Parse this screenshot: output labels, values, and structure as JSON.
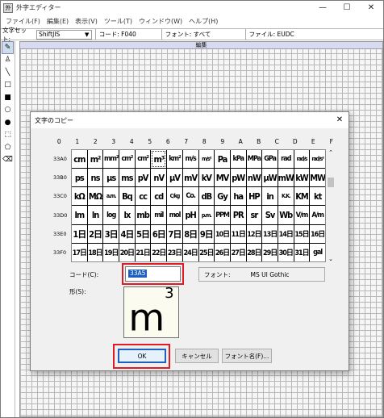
{
  "window": {
    "title": "外字エディター",
    "icon": "外",
    "min": "—",
    "max": "☐",
    "close": "✕"
  },
  "menu": [
    "ファイル(F)",
    "編集(E)",
    "表示(V)",
    "ツール(T)",
    "ウィンドウ(W)",
    "ヘルプ(H)"
  ],
  "infobar": {
    "charset_label": "文字セット:",
    "charset_value": "ShiftJIS",
    "code": "コード: F040",
    "font": "フォント: すべて",
    "file": "ファイル: EUDC"
  },
  "tools": [
    "pencil-icon",
    "brush-icon",
    "line-icon",
    "hollow-rect-icon",
    "filled-rect-icon",
    "hollow-ellipse-icon",
    "filled-ellipse-icon",
    "rect-select-icon",
    "freeform-select-icon",
    "eraser-icon"
  ],
  "canvas": {
    "header": "編集"
  },
  "dialog": {
    "title": "文字のコピー",
    "close": "✕",
    "columns": [
      "0",
      "1",
      "2",
      "3",
      "4",
      "5",
      "6",
      "7",
      "8",
      "9",
      "A",
      "B",
      "C",
      "D",
      "E",
      "F"
    ],
    "rows": [
      {
        "label": "33A0",
        "chars": [
          "cm",
          "m²",
          "mm²",
          "cm²",
          "cm²",
          "m³",
          "km²",
          "m/s",
          "m/s²",
          "Pa",
          "kPa",
          "MPa",
          "GPa",
          "rad",
          "rad/s",
          "rad/s²"
        ]
      },
      {
        "label": "33B0",
        "chars": [
          "ps",
          "ns",
          "μs",
          "ms",
          "pV",
          "nV",
          "μV",
          "mV",
          "kV",
          "MV",
          "pW",
          "nW",
          "μW",
          "mW",
          "kW",
          "MW"
        ]
      },
      {
        "label": "33C0",
        "chars": [
          "kΩ",
          "MΩ",
          "a.m.",
          "Bq",
          "cc",
          "cd",
          "C/kg",
          "Co.",
          "dB",
          "Gy",
          "ha",
          "HP",
          "in",
          "K.K.",
          "KM",
          "kt"
        ]
      },
      {
        "label": "33D0",
        "chars": [
          "lm",
          "ln",
          "log",
          "lx",
          "mb",
          "mil",
          "mol",
          "pH",
          "p.m.",
          "PPM",
          "PR",
          "sr",
          "Sv",
          "Wb",
          "V/m",
          "A/m"
        ]
      },
      {
        "label": "33E0",
        "chars": [
          "1日",
          "2日",
          "3日",
          "4日",
          "5日",
          "6日",
          "7日",
          "8日",
          "9日",
          "10日",
          "11日",
          "12日",
          "13日",
          "14日",
          "15日",
          "16日"
        ]
      },
      {
        "label": "33F0",
        "chars": [
          "17日",
          "18日",
          "19日",
          "20日",
          "21日",
          "22日",
          "23日",
          "24日",
          "25日",
          "26日",
          "27日",
          "28日",
          "29日",
          "30日",
          "31日",
          "gal"
        ]
      }
    ],
    "code_label": "コード(C):",
    "code_value": "33A5",
    "font_label": "フォント:",
    "font_value": "MS UI Gothic",
    "shape_label": "形(S):",
    "preview_char": "m",
    "preview_sup": "3",
    "ok": "OK",
    "cancel": "キャンセル",
    "font_name": "フォント名(F)..."
  },
  "accent": {
    "selection": "#1f5fbf",
    "highlight_box": "#e01b24"
  }
}
